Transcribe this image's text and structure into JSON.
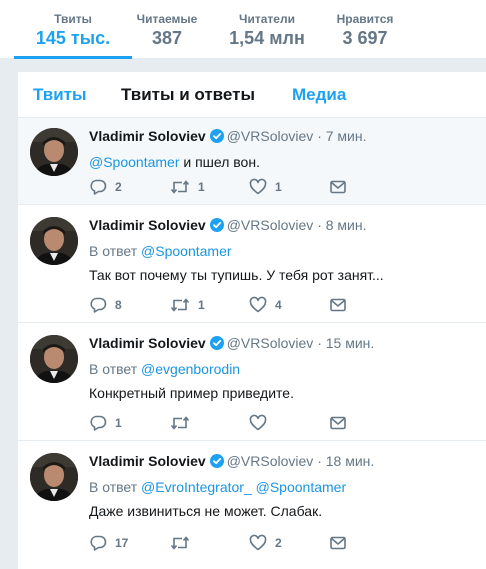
{
  "stats": [
    {
      "label": "Твиты",
      "value": "145 тыс.",
      "active": true
    },
    {
      "label": "Читаемые",
      "value": "387"
    },
    {
      "label": "Читатели",
      "value": "1,54 млн"
    },
    {
      "label": "Нравится",
      "value": "3 697"
    }
  ],
  "tabs": [
    {
      "label": "Твиты"
    },
    {
      "label": "Твиты и ответы",
      "current": true
    },
    {
      "label": "Медиа"
    }
  ],
  "tweets": [
    {
      "name": "Vladimir Soloviev",
      "handle": "@VRSoloviev",
      "separator": "·",
      "time": "7 мин.",
      "mention": "@Spoontamer",
      "text": " и пшел вон.",
      "replies": "2",
      "retweets": "1",
      "likes": "1"
    },
    {
      "name": "Vladimir Soloviev",
      "handle": "@VRSoloviev",
      "separator": "·",
      "time": "8 мин.",
      "reply_prefix": "В ответ",
      "reply_mentions": "@Spoontamer",
      "text": "Так вот почему ты тупишь. У тебя рот занят...",
      "replies": "8",
      "retweets": "1",
      "likes": "4"
    },
    {
      "name": "Vladimir Soloviev",
      "handle": "@VRSoloviev",
      "separator": "·",
      "time": "15 мин.",
      "reply_prefix": "В ответ",
      "reply_mentions": "@evgenborodin",
      "text": "Конкретный пример приведите.",
      "replies": "1",
      "retweets": "",
      "likes": ""
    },
    {
      "name": "Vladimir Soloviev",
      "handle": "@VRSoloviev",
      "separator": "·",
      "time": "18 мин.",
      "reply_prefix": "В ответ",
      "reply_mentions": "@EvroIntegrator_ @Spoontamer",
      "text": "Даже извиниться не может. Слабак.",
      "replies": "17",
      "retweets": "",
      "likes": "2"
    }
  ],
  "icons": {
    "reply": "reply-icon",
    "retweet": "retweet-icon",
    "like": "heart-icon",
    "dm": "envelope-icon",
    "verified": "verified-badge-icon"
  },
  "colors": {
    "accent": "#1da1f2",
    "mention": "#1b95e0",
    "secondary_text": "#657786",
    "background": "#e6ecf0"
  }
}
